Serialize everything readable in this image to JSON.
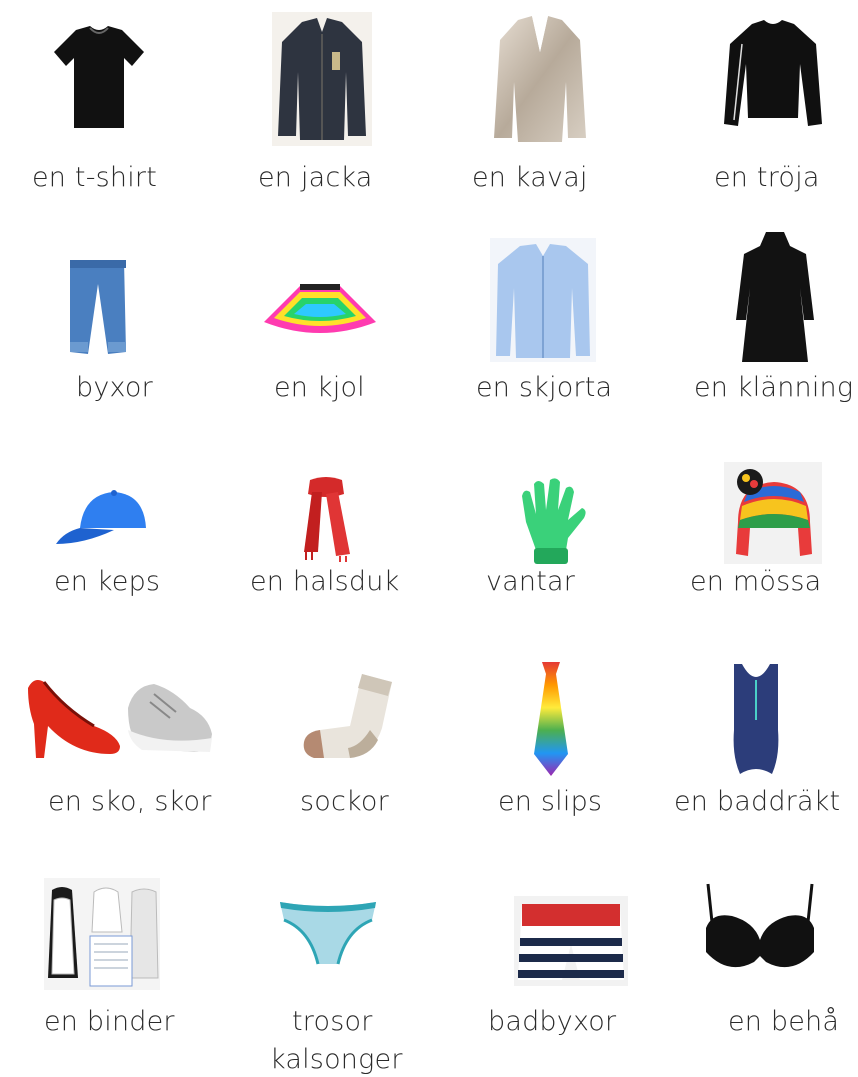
{
  "items": [
    {
      "label": "en t-shirt",
      "icon": "t-shirt-icon"
    },
    {
      "label": "en jacka",
      "icon": "jacket-icon"
    },
    {
      "label": "en kavaj",
      "icon": "blazer-icon"
    },
    {
      "label": "en tröja",
      "icon": "sweater-icon"
    },
    {
      "label": "byxor",
      "icon": "trousers-icon"
    },
    {
      "label": "en kjol",
      "icon": "skirt-icon"
    },
    {
      "label": "en skjorta",
      "icon": "shirt-icon"
    },
    {
      "label": "en klänning",
      "icon": "dress-icon"
    },
    {
      "label": "en keps",
      "icon": "cap-icon"
    },
    {
      "label": "en halsduk",
      "icon": "scarf-icon"
    },
    {
      "label": "vantar",
      "icon": "glove-icon"
    },
    {
      "label": "en mössa",
      "icon": "beanie-icon"
    },
    {
      "label": "en sko, skor",
      "icon": "shoes-icon"
    },
    {
      "label": "sockor",
      "icon": "sock-icon"
    },
    {
      "label": "en slips",
      "icon": "tie-icon"
    },
    {
      "label": "en baddräkt",
      "icon": "swimsuit-icon"
    },
    {
      "label": "en binder",
      "icon": "binder-icon"
    },
    {
      "label": "trosor",
      "label2": "kalsonger",
      "icon": "underwear-icon"
    },
    {
      "label": "badbyxor",
      "icon": "swim-shorts-icon"
    },
    {
      "label": "en behå",
      "icon": "bra-icon"
    }
  ]
}
